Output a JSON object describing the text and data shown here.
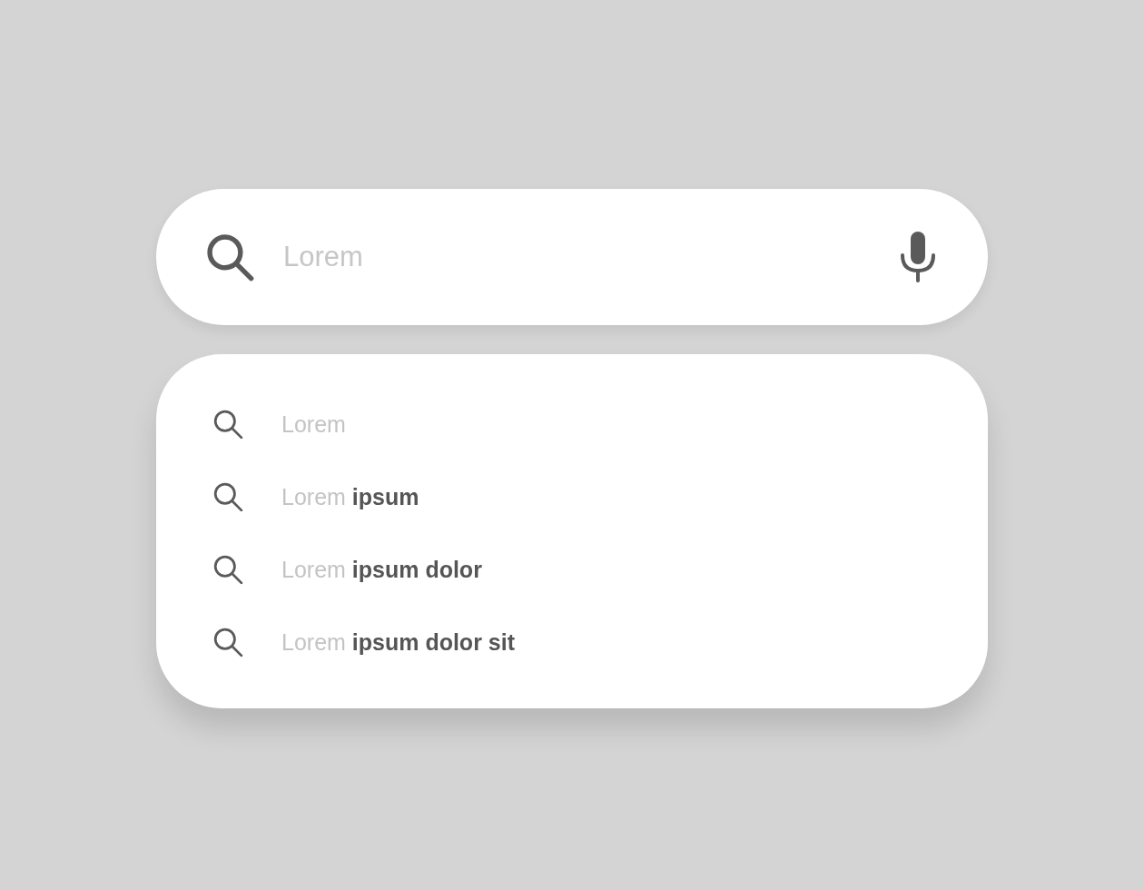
{
  "search": {
    "placeholder": "Lorem"
  },
  "suggestions": [
    {
      "text": "Lorem"
    },
    {
      "text": "Lorem **ipsum**"
    },
    {
      "text": "Lorem **ipsum dolor**"
    },
    {
      "text": "Lorem **ipsum dolor sit**"
    }
  ]
}
